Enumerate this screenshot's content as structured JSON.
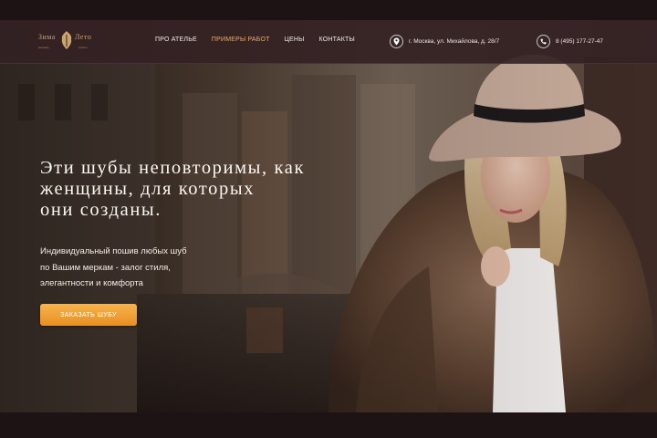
{
  "logo": {
    "left_word": "Зима",
    "right_word": "Лето",
    "left_sub": "меховое",
    "right_sub": "ателье"
  },
  "nav": {
    "items": [
      "ПРО АТЕЛЬЕ",
      "ПРИМЕРЫ РАБОТ",
      "ЦЕНЫ",
      "КОНТАКТЫ"
    ],
    "active_index": 1
  },
  "contacts": {
    "address": "г. Москва, ул. Михайлова, д. 28/7",
    "phone": "8 (495) 177-27-47",
    "address_icon": "location-pin-icon",
    "phone_icon": "phone-icon"
  },
  "hero": {
    "title_lines": [
      "Эти шубы неповторимы, как",
      "женщины, для которых",
      "они созданы."
    ],
    "subtitle_lines": [
      "Индивидуальный пошив любых шуб",
      "по Вашим меркам - залог стиля,",
      "элегантности и комфорта"
    ],
    "cta_label": "ЗАКАЗАТЬ ШУБУ"
  },
  "colors": {
    "accent": "#e9b067",
    "button": "#f2a33a",
    "header": "#342224",
    "text": "#fbf7f1"
  }
}
